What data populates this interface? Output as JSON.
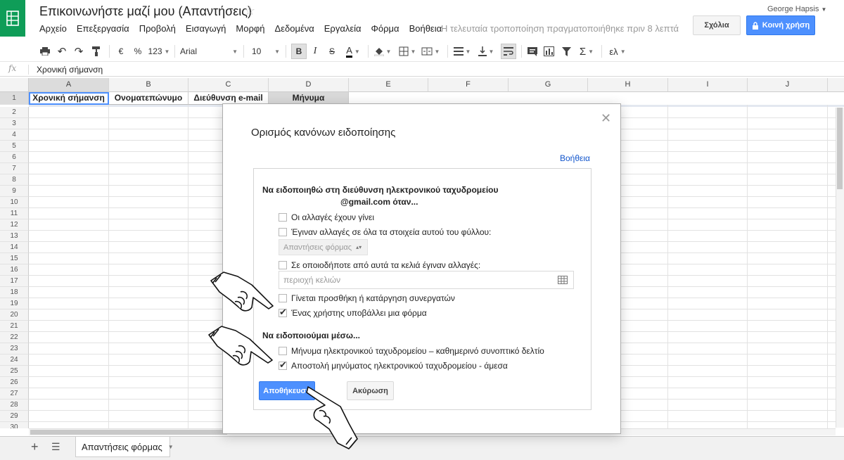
{
  "header": {
    "doc_title": "Επικοινωνήστε μαζί μου (Απαντήσεις)",
    "user_name": "George Hapsis",
    "comments_label": "Σχόλια",
    "share_label": "Κοινή χρήση",
    "last_edit": "Η τελευταία τροποποίηση πραγματοποιήθηκε πριν 8 λεπτά",
    "menu": [
      "Αρχείο",
      "Επεξεργασία",
      "Προβολή",
      "Εισαγωγή",
      "Μορφή",
      "Δεδομένα",
      "Εργαλεία",
      "Φόρμα",
      "Βοήθεια"
    ]
  },
  "toolbar": {
    "currency": "€",
    "percent": "%",
    "number_format": "123",
    "font": "Arial",
    "font_size": "10",
    "bold": "B",
    "italic": "I",
    "strike": "S",
    "text_color": "A",
    "sigma": "Σ",
    "lang": "ελ"
  },
  "formula_bar": {
    "fx": "fx",
    "value": "Χρονική σήμανση"
  },
  "grid": {
    "columns": [
      "A",
      "B",
      "C",
      "D",
      "E",
      "F",
      "G",
      "H",
      "I",
      "J"
    ],
    "rows": [
      "1",
      "2",
      "3",
      "4",
      "5",
      "6",
      "7",
      "8",
      "9",
      "10",
      "11",
      "12",
      "13",
      "14",
      "15",
      "16",
      "17",
      "18",
      "19",
      "20",
      "21",
      "22",
      "23",
      "24",
      "25",
      "26",
      "27",
      "28",
      "29",
      "30"
    ],
    "header_cells": [
      "Χρονική σήμανση",
      "Ονοματεπώνυμο",
      "Διεύθυνση e-mail",
      "Μήνυμα"
    ]
  },
  "sheets": {
    "tab_label": "Απαντήσεις φόρμας"
  },
  "dialog": {
    "title": "Ορισμός κανόνων ειδοποίησης",
    "help": "Βοήθεια",
    "notify_title": "Να ειδοποιηθώ στη διεύθυνση ηλεκτρονικού ταχυδρομείου",
    "notify_email": "@gmail.com όταν...",
    "opt_any_change": "Οι αλλαγές έχουν γίνει",
    "opt_sheet_change": "Έγιναν αλλαγές σε όλα τα στοιχεία αυτού του φύλλου:",
    "sheet_select": "Απαντήσεις φόρμας",
    "opt_cells_change": "Σε οποιοδήποτε από αυτά τα κελιά έγιναν αλλαγές:",
    "range_placeholder": "περιοχή κελιών",
    "opt_collaborators": "Γίνεται προσθήκη ή κατάργηση συνεργατών",
    "opt_form_submit": "Ένας χρήστης υποβάλλει μια φόρμα",
    "via_title": "Να ειδοποιούμαι μέσω...",
    "via_daily": "Μήνυμα ηλεκτρονικού ταχυδρομείου – καθημερινό συνοπτικό δελτίο",
    "via_immediate": "Αποστολή μηνύματος ηλεκτρονικού ταχυδρομείου - άμεσα",
    "save": "Αποθήκευση",
    "cancel": "Ακύρωση"
  }
}
